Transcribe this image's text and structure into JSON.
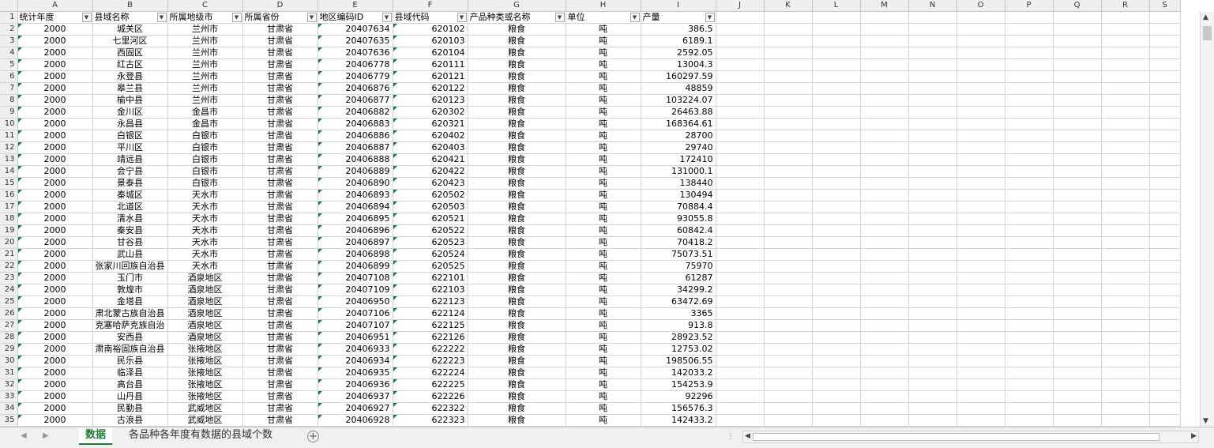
{
  "column_letters": [
    "A",
    "B",
    "C",
    "D",
    "E",
    "F",
    "G",
    "H",
    "I",
    "J",
    "K",
    "L",
    "M",
    "N",
    "O",
    "P",
    "Q",
    "R",
    "S"
  ],
  "headers": [
    "统计年度",
    "县域名称",
    "所属地级市",
    "所属省份",
    "地区编码ID",
    "县域代码",
    "产品种类或名称",
    "单位",
    "产量"
  ],
  "header_row_number": "1",
  "rows": [
    {
      "n": "2",
      "c": [
        "2000",
        "城关区",
        "兰州市",
        "甘肃省",
        "20407634",
        "620102",
        "粮食",
        "吨",
        "386.5"
      ]
    },
    {
      "n": "3",
      "c": [
        "2000",
        "七里河区",
        "兰州市",
        "甘肃省",
        "20407635",
        "620103",
        "粮食",
        "吨",
        "6189.1"
      ]
    },
    {
      "n": "4",
      "c": [
        "2000",
        "西固区",
        "兰州市",
        "甘肃省",
        "20407636",
        "620104",
        "粮食",
        "吨",
        "2592.05"
      ]
    },
    {
      "n": "5",
      "c": [
        "2000",
        "红古区",
        "兰州市",
        "甘肃省",
        "20406778",
        "620111",
        "粮食",
        "吨",
        "13004.3"
      ]
    },
    {
      "n": "6",
      "c": [
        "2000",
        "永登县",
        "兰州市",
        "甘肃省",
        "20406779",
        "620121",
        "粮食",
        "吨",
        "160297.59"
      ]
    },
    {
      "n": "7",
      "c": [
        "2000",
        "皋兰县",
        "兰州市",
        "甘肃省",
        "20406876",
        "620122",
        "粮食",
        "吨",
        "48859"
      ]
    },
    {
      "n": "8",
      "c": [
        "2000",
        "榆中县",
        "兰州市",
        "甘肃省",
        "20406877",
        "620123",
        "粮食",
        "吨",
        "103224.07"
      ]
    },
    {
      "n": "9",
      "c": [
        "2000",
        "金川区",
        "金昌市",
        "甘肃省",
        "20406882",
        "620302",
        "粮食",
        "吨",
        "26463.88"
      ]
    },
    {
      "n": "10",
      "c": [
        "2000",
        "永昌县",
        "金昌市",
        "甘肃省",
        "20406883",
        "620321",
        "粮食",
        "吨",
        "168364.61"
      ]
    },
    {
      "n": "11",
      "c": [
        "2000",
        "白银区",
        "白银市",
        "甘肃省",
        "20406886",
        "620402",
        "粮食",
        "吨",
        "28700"
      ]
    },
    {
      "n": "12",
      "c": [
        "2000",
        "平川区",
        "白银市",
        "甘肃省",
        "20406887",
        "620403",
        "粮食",
        "吨",
        "29740"
      ]
    },
    {
      "n": "13",
      "c": [
        "2000",
        "靖远县",
        "白银市",
        "甘肃省",
        "20406888",
        "620421",
        "粮食",
        "吨",
        "172410"
      ]
    },
    {
      "n": "14",
      "c": [
        "2000",
        "会宁县",
        "白银市",
        "甘肃省",
        "20406889",
        "620422",
        "粮食",
        "吨",
        "131000.1"
      ]
    },
    {
      "n": "15",
      "c": [
        "2000",
        "景泰县",
        "白银市",
        "甘肃省",
        "20406890",
        "620423",
        "粮食",
        "吨",
        "138440"
      ]
    },
    {
      "n": "16",
      "c": [
        "2000",
        "秦城区",
        "天水市",
        "甘肃省",
        "20406893",
        "620502",
        "粮食",
        "吨",
        "130494"
      ]
    },
    {
      "n": "17",
      "c": [
        "2000",
        "北道区",
        "天水市",
        "甘肃省",
        "20406894",
        "620503",
        "粮食",
        "吨",
        "70884.4"
      ]
    },
    {
      "n": "18",
      "c": [
        "2000",
        "清水县",
        "天水市",
        "甘肃省",
        "20406895",
        "620521",
        "粮食",
        "吨",
        "93055.8"
      ]
    },
    {
      "n": "19",
      "c": [
        "2000",
        "秦安县",
        "天水市",
        "甘肃省",
        "20406896",
        "620522",
        "粮食",
        "吨",
        "60842.4"
      ]
    },
    {
      "n": "20",
      "c": [
        "2000",
        "甘谷县",
        "天水市",
        "甘肃省",
        "20406897",
        "620523",
        "粮食",
        "吨",
        "70418.2"
      ]
    },
    {
      "n": "21",
      "c": [
        "2000",
        "武山县",
        "天水市",
        "甘肃省",
        "20406898",
        "620524",
        "粮食",
        "吨",
        "75073.51"
      ]
    },
    {
      "n": "22",
      "c": [
        "2000",
        "张家川回族自治县",
        "天水市",
        "甘肃省",
        "20406899",
        "620525",
        "粮食",
        "吨",
        "75970"
      ]
    },
    {
      "n": "23",
      "c": [
        "2000",
        "玉门市",
        "酒泉地区",
        "甘肃省",
        "20407108",
        "622101",
        "粮食",
        "吨",
        "61287"
      ]
    },
    {
      "n": "24",
      "c": [
        "2000",
        "敦煌市",
        "酒泉地区",
        "甘肃省",
        "20407109",
        "622103",
        "粮食",
        "吨",
        "34299.2"
      ]
    },
    {
      "n": "25",
      "c": [
        "2000",
        "金塔县",
        "酒泉地区",
        "甘肃省",
        "20406950",
        "622123",
        "粮食",
        "吨",
        "63472.69"
      ]
    },
    {
      "n": "26",
      "c": [
        "2000",
        "肃北蒙古族自治县",
        "酒泉地区",
        "甘肃省",
        "20407106",
        "622124",
        "粮食",
        "吨",
        "3365"
      ]
    },
    {
      "n": "27",
      "c": [
        "2000",
        "克塞哈萨克族自治",
        "酒泉地区",
        "甘肃省",
        "20407107",
        "622125",
        "粮食",
        "吨",
        "913.8"
      ]
    },
    {
      "n": "28",
      "c": [
        "2000",
        "安西县",
        "酒泉地区",
        "甘肃省",
        "20406951",
        "622126",
        "粮食",
        "吨",
        "28923.52"
      ]
    },
    {
      "n": "29",
      "c": [
        "2000",
        "肃南裕固族自治县",
        "张掖地区",
        "甘肃省",
        "20406933",
        "622222",
        "粮食",
        "吨",
        "12753.02"
      ]
    },
    {
      "n": "30",
      "c": [
        "2000",
        "民乐县",
        "张掖地区",
        "甘肃省",
        "20406934",
        "622223",
        "粮食",
        "吨",
        "198506.55"
      ]
    },
    {
      "n": "31",
      "c": [
        "2000",
        "临泽县",
        "张掖地区",
        "甘肃省",
        "20406935",
        "622224",
        "粮食",
        "吨",
        "142033.2"
      ]
    },
    {
      "n": "32",
      "c": [
        "2000",
        "高台县",
        "张掖地区",
        "甘肃省",
        "20406936",
        "622225",
        "粮食",
        "吨",
        "154253.9"
      ]
    },
    {
      "n": "33",
      "c": [
        "2000",
        "山丹县",
        "张掖地区",
        "甘肃省",
        "20406937",
        "622226",
        "粮食",
        "吨",
        "92296"
      ]
    },
    {
      "n": "34",
      "c": [
        "2000",
        "民勤县",
        "武威地区",
        "甘肃省",
        "20406927",
        "622322",
        "粮食",
        "吨",
        "156576.3"
      ]
    },
    {
      "n": "35",
      "c": [
        "2000",
        "古浪县",
        "武威地区",
        "甘肃省",
        "20406928",
        "622323",
        "粮食",
        "吨",
        "142433.2"
      ]
    }
  ],
  "sheet_tabs": {
    "active": "数据",
    "other": "各品种各年度有数据的县域个数"
  },
  "colors": {
    "accent": "#1e7b34",
    "grid": "#d4d4d4",
    "header_bg": "#efefef"
  },
  "icons": {
    "add_sheet": "plus-circle-icon",
    "filter": "filter-dropdown-icon"
  }
}
